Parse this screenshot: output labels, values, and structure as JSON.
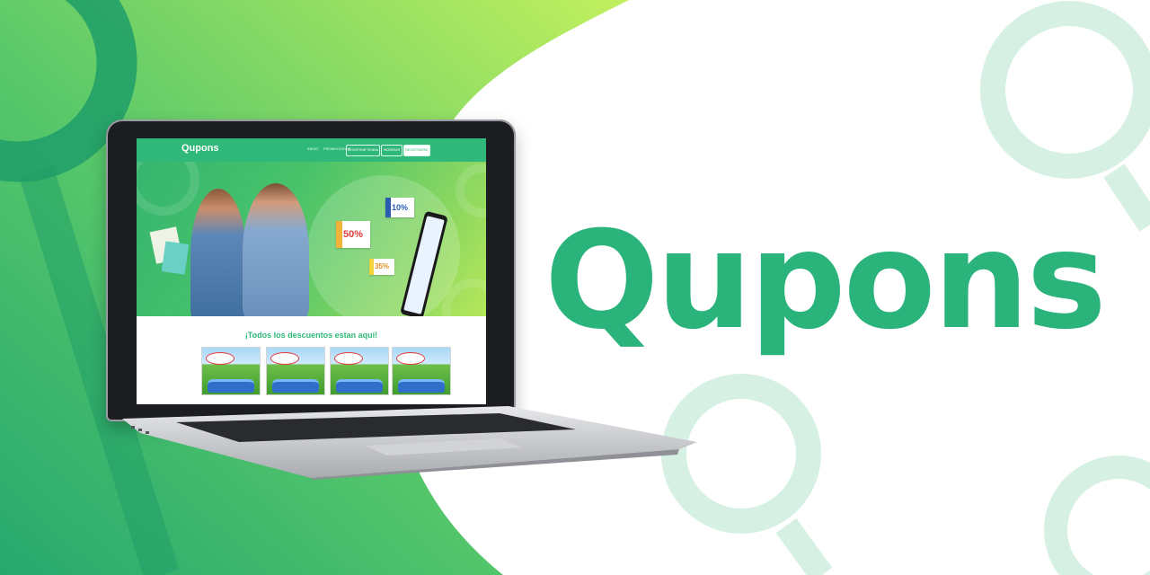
{
  "brand": {
    "name": "Qupons"
  },
  "colors": {
    "brand_green": "#2ab37a",
    "bg_dark_green": "#2aa870",
    "bg_light_green": "#b5ea62",
    "q_mark": "#d6f0e4"
  },
  "site": {
    "logo": "Qupons",
    "nav": [
      "INICIO",
      "PROMOCIONES"
    ],
    "nav_buttons": [
      "REGISTRAR TIENDA",
      "INGRESAR",
      "REGISTRARSE"
    ],
    "section_title": "¡Todos los descuentos estan aquí!",
    "coupons": [
      "10%",
      "50%",
      "35%"
    ],
    "product_cards": 4
  },
  "icons": [
    "q-logo-icon",
    "shopping-bag-icon",
    "smartphone-icon",
    "coupon-icon"
  ]
}
